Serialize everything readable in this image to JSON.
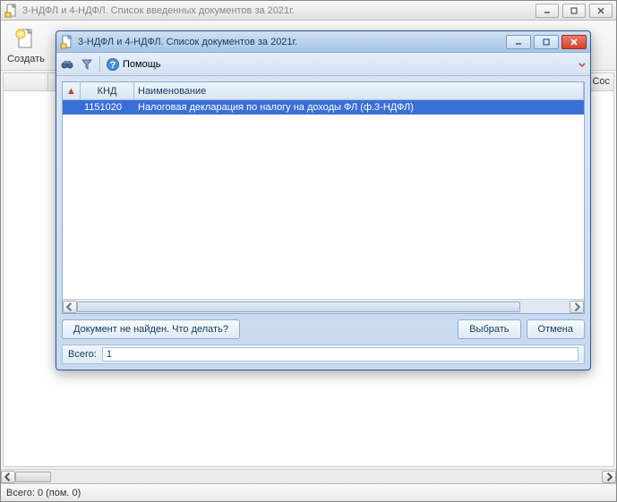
{
  "outer": {
    "title": "3-НДФЛ и 4-НДФЛ. Список введенных документов за 2021г."
  },
  "toolbar": {
    "create_label": "Создать"
  },
  "grid": {
    "right_label": "Сос"
  },
  "status": {
    "text": "Всего: 0 (пом. 0)"
  },
  "dialog": {
    "title": "3-НДФЛ и 4-НДФЛ. Список документов за 2021г.",
    "help_label": "Помощь",
    "columns": {
      "knd": "КНД",
      "name": "Наименование"
    },
    "rows": [
      {
        "knd": "1151020",
        "name": "Налоговая декларация по налогу на доходы ФЛ (ф.3-НДФЛ)"
      }
    ],
    "not_found_label": "Документ не найден. Что делать?",
    "select_label": "Выбрать",
    "cancel_label": "Отмена",
    "total_label": "Всего:",
    "total_value": "1"
  }
}
